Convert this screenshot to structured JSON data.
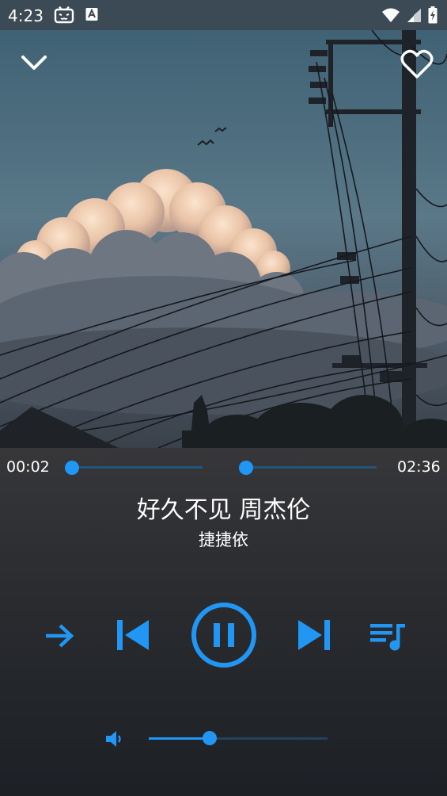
{
  "status_bar": {
    "time": "4:23",
    "icons": [
      "bilibili-icon",
      "keyboard-a-icon",
      "wifi-icon",
      "signal-icon",
      "battery-charging-icon"
    ]
  },
  "header": {
    "collapse_icon": "chevron-down-icon",
    "favorite_icon": "heart-outline-icon"
  },
  "player": {
    "elapsed": "00:02",
    "duration": "02:36",
    "progress_fraction": 0.013,
    "song_title": "好久不见 周杰伦",
    "artist": "捷捷依",
    "controls": [
      "order-mode-icon",
      "previous-icon",
      "pause-icon",
      "next-icon",
      "playlist-icon"
    ],
    "volume_fraction": 0.34
  },
  "colors": {
    "accent": "#2196f3",
    "track": "#24557d",
    "status_bar": "#3b4a55"
  }
}
